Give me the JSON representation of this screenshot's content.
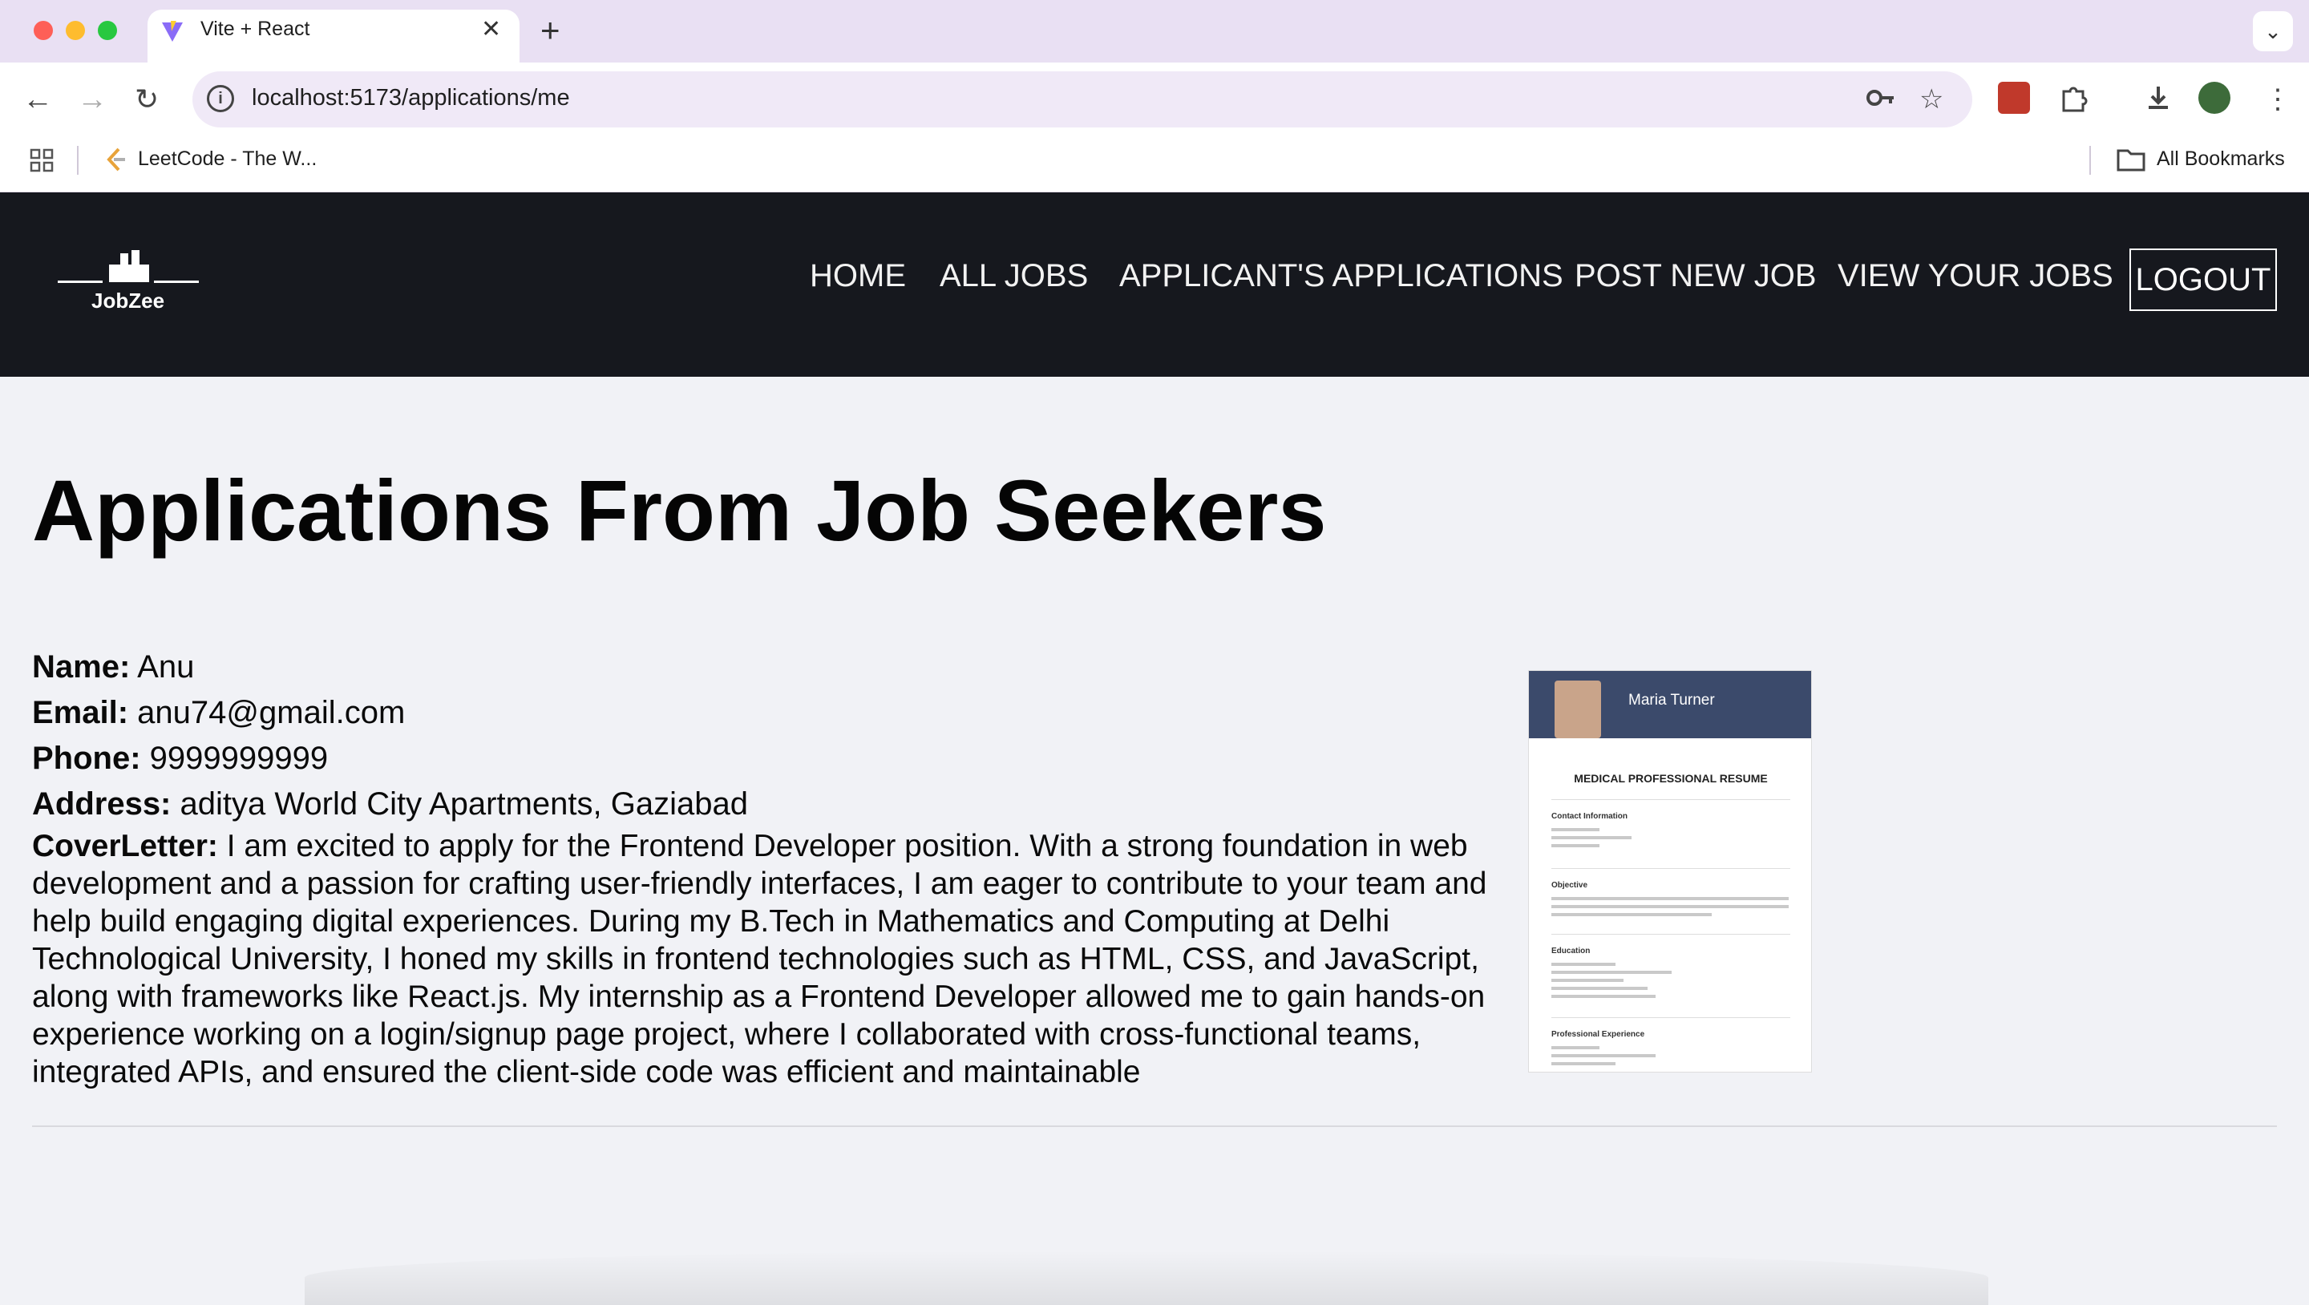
{
  "browser": {
    "tab_title": "Vite + React",
    "url": "localhost:5173/applications/me",
    "bookmark_label": "LeetCode - The W...",
    "all_bookmarks_label": "All Bookmarks"
  },
  "site": {
    "logo_text": "JobZee",
    "nav": [
      {
        "label": "HOME"
      },
      {
        "label": "ALL JOBS"
      },
      {
        "label": "APPLICANT'S APPLICATIONS"
      },
      {
        "label": "POST NEW JOB"
      },
      {
        "label": "VIEW YOUR JOBS"
      }
    ],
    "logout_label": "LOGOUT"
  },
  "main": {
    "title": "Applications From Job Seekers",
    "application": {
      "name_label": "Name:",
      "name": "Anu",
      "email_label": "Email:",
      "email": "anu74@gmail.com",
      "phone_label": "Phone:",
      "phone": "9999999999",
      "address_label": "Address:",
      "address": "aditya World City Apartments, Gaziabad",
      "cover_label": "CoverLetter:",
      "cover_letter": "I am excited to apply for the Frontend Developer position. With a strong foundation in web development and a passion for crafting user-friendly interfaces, I am eager to contribute to your team and help build engaging digital experiences. During my B.Tech in Mathematics and Computing at Delhi Technological University, I honed my skills in frontend technologies such as HTML, CSS, and JavaScript, along with frameworks like React.js. My internship as a Frontend Developer allowed me to gain hands-on experience working on a login/signup page project, where I collaborated with cross-functional teams, integrated APIs, and ensured the client-side code was efficient and maintainable",
      "resume": {
        "name": "Maria Turner",
        "title": "MEDICAL PROFESSIONAL RESUME",
        "sections": [
          "Contact Information",
          "Objective",
          "Education",
          "Professional Experience"
        ]
      }
    }
  },
  "colors": {
    "header_bg": "#16181e",
    "page_bg": "#f1f2f6",
    "tabbar_bg": "#e9e0f3"
  }
}
